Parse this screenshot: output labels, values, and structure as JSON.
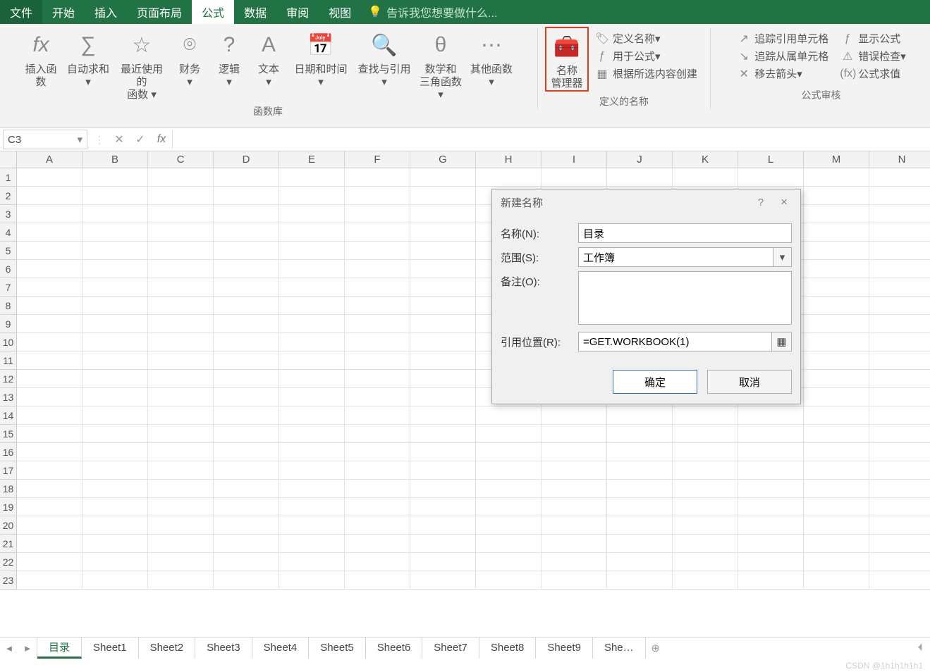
{
  "tabs": {
    "file": "文件",
    "home": "开始",
    "insert": "插入",
    "layout": "页面布局",
    "formulas": "公式",
    "data": "数据",
    "review": "审阅",
    "view": "视图",
    "tellme": "告诉我您想要做什么..."
  },
  "ribbon": {
    "funclib_title": "函数库",
    "insert_fn": "插入函数",
    "autosum": "自动求和",
    "recent": "最近使用的\n函数",
    "recent1": "最近使用的",
    "recent2": "函数",
    "finance": "财务",
    "logic": "逻辑",
    "text": "文本",
    "datetime": "日期和时间",
    "lookup": "查找与引用",
    "math1": "数学和",
    "math2": "三角函数",
    "other": "其他函数",
    "name_manager1": "名称",
    "name_manager2": "管理器",
    "defined_names_title": "定义的名称",
    "define_name": "定义名称",
    "use_in_formula": "用于公式",
    "create_from_selection": "根据所选内容创建",
    "audit_title": "公式审核",
    "trace_precedents": "追踪引用单元格",
    "trace_dependents": "追踪从属单元格",
    "remove_arrows": "移去箭头",
    "show_formulas": "显示公式",
    "error_check": "错误检查",
    "evaluate": "公式求值"
  },
  "namebox": "C3",
  "columns": [
    "A",
    "B",
    "C",
    "D",
    "E",
    "F",
    "G",
    "H",
    "I",
    "J",
    "K",
    "L",
    "M",
    "N"
  ],
  "dialog": {
    "title": "新建名称",
    "help": "?",
    "close": "×",
    "name_lbl": "名称(N):",
    "name_val": "目录",
    "scope_lbl": "范围(S):",
    "scope_val": "工作簿",
    "comment_lbl": "备注(O):",
    "ref_lbl": "引用位置(R):",
    "ref_val": "=GET.WORKBOOK(1)",
    "ok": "确定",
    "cancel": "取消"
  },
  "sheets": [
    "目录",
    "Sheet1",
    "Sheet2",
    "Sheet3",
    "Sheet4",
    "Sheet5",
    "Sheet6",
    "Sheet7",
    "Sheet8",
    "Sheet9",
    "She…"
  ],
  "watermark": "CSDN @1h1h1h1h1"
}
